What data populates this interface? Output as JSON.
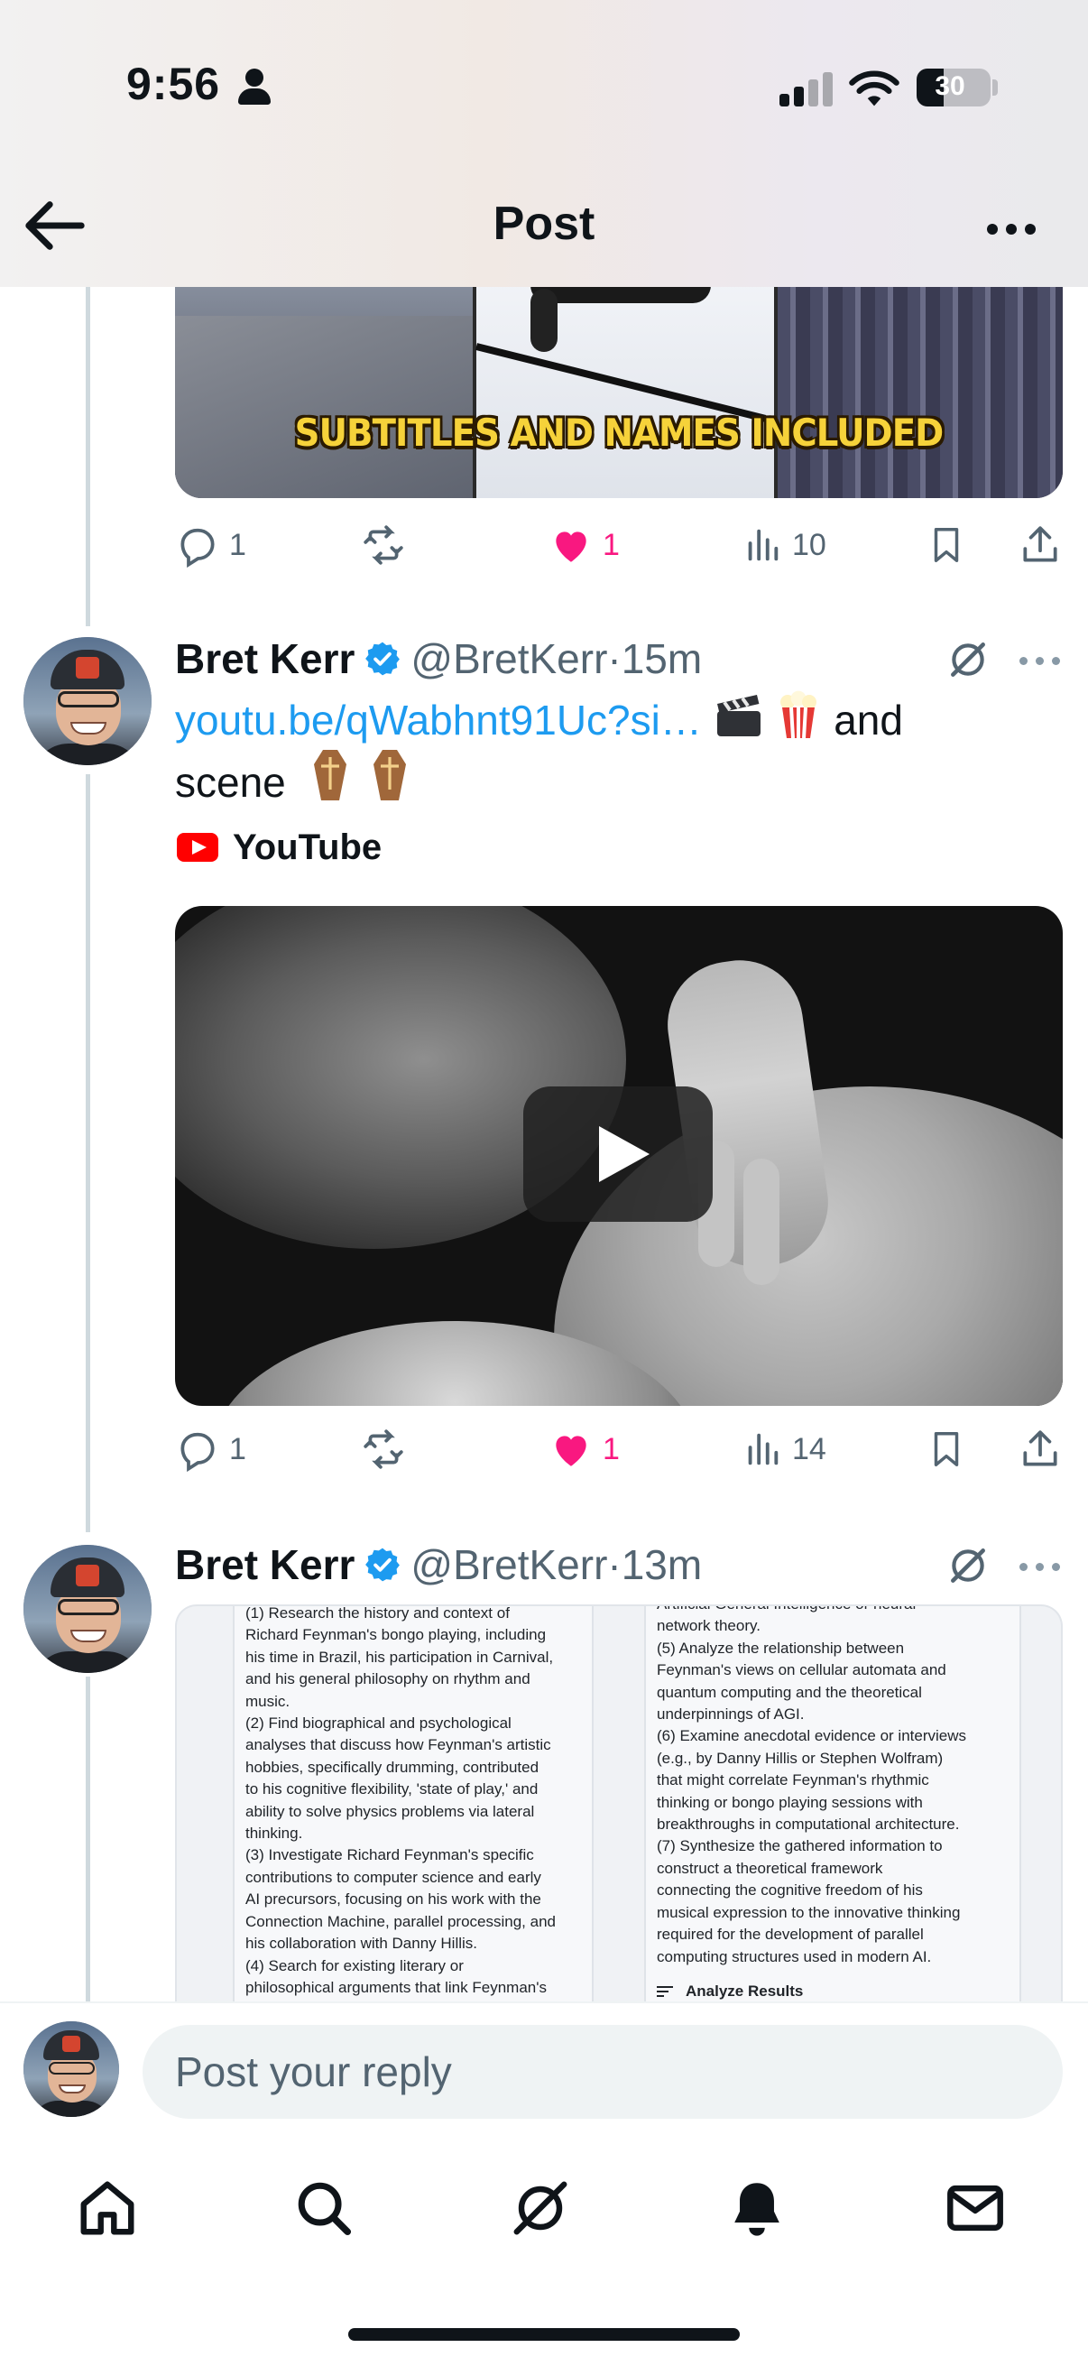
{
  "status_bar": {
    "time": "9:56",
    "battery": "30"
  },
  "header": {
    "title": "Post"
  },
  "post1": {
    "media_subtitle": "SUBTITLES AND NAMES INCLUDED",
    "stats": {
      "replies": "1",
      "likes": "1",
      "views": "10"
    }
  },
  "post2": {
    "author_name": "Bret Kerr",
    "handle": "@BretKerr",
    "time": "15m",
    "link": "youtu.be/qWabhnt91Uc?si…",
    "text_after_link": " and",
    "text_line2": "scene",
    "source": "YouTube",
    "stats": {
      "replies": "1",
      "likes": "1",
      "views": "14"
    }
  },
  "post3": {
    "author_name": "Bret Kerr",
    "handle": "@BretKerr",
    "time": "13m",
    "doc_left_lines": [
      "(1) Research the history and context of",
      "Richard Feynman's bongo playing, including",
      "his time in Brazil, his participation in Carnival,",
      "and his general philosophy on rhythm and",
      "music.",
      "(2) Find biographical and psychological",
      "analyses that discuss how Feynman's artistic",
      "hobbies, specifically drumming, contributed",
      "to his cognitive flexibility, 'state of play,' and",
      "ability to solve physics problems via lateral",
      "thinking.",
      "(3) Investigate Richard Feynman's specific",
      "contributions to computer science and early",
      "AI precursors, focusing on his work with the",
      "Connection Machine, parallel processing, and",
      "his collaboration with Danny Hillis.",
      "(4) Search for existing literary or",
      "philosophical arguments that link Feynman's"
    ],
    "doc_right_lines": [
      "Artificial General Intelligence or neural",
      "network theory.",
      "(5) Analyze the relationship between",
      "Feynman's views on cellular automata and",
      "quantum computing and the theoretical",
      "underpinnings of AGI.",
      "(6) Examine anecdotal evidence or interviews",
      "(e.g., by Danny Hillis or Stephen Wolfram)",
      "that might correlate Feynman's rhythmic",
      "thinking or bongo playing sessions with",
      "breakthroughs in computational architecture.",
      "(7) Synthesize the gathered information to",
      "construct a theoretical framework",
      "connecting the cognitive freedom of his",
      "musical expression to the innovative thinking",
      "required for the development of parallel",
      "computing structures used in modern AI."
    ],
    "doc_analyze": "Analyze Results"
  },
  "reply": {
    "placeholder": "Post your reply"
  },
  "icons": [
    "back-arrow-icon",
    "more-icon",
    "reply-icon",
    "repost-icon",
    "heart-icon",
    "views-icon",
    "bookmark-icon",
    "share-icon",
    "verified-icon",
    "grok-icon",
    "youtube-icon",
    "clapper-icon",
    "popcorn-icon",
    "coffin-icon",
    "home-icon",
    "search-icon",
    "notifications-icon",
    "messages-icon"
  ],
  "colors": {
    "accent": "#1d9bf0",
    "like": "#f91880",
    "muted": "#536471"
  }
}
